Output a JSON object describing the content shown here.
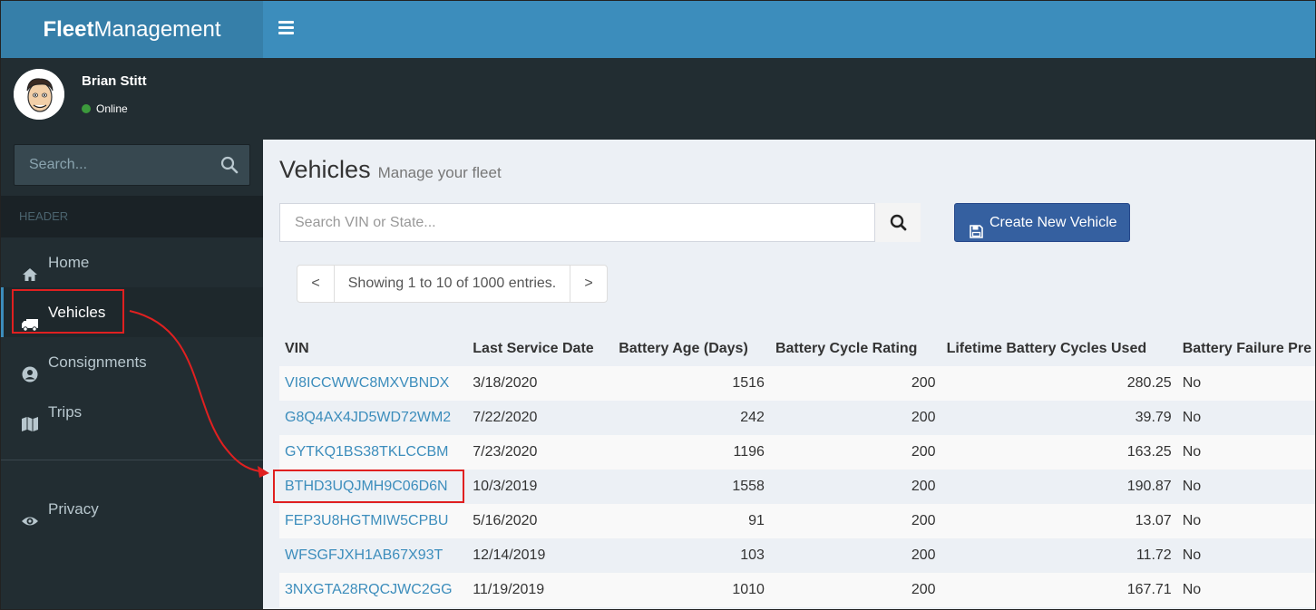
{
  "brand": {
    "bold": "Fleet",
    "rest": "Management"
  },
  "user": {
    "name": "Brian Stitt",
    "status": "Online"
  },
  "sidebar": {
    "search_placeholder": "Search...",
    "header": "HEADER",
    "items": [
      {
        "label": "Home",
        "icon": "home-icon"
      },
      {
        "label": "Vehicles",
        "icon": "truck-icon"
      },
      {
        "label": "Consignments",
        "icon": "user-circle-icon"
      },
      {
        "label": "Trips",
        "icon": "map-icon"
      },
      {
        "label": "Privacy",
        "icon": "eye-icon"
      }
    ]
  },
  "page": {
    "title": "Vehicles",
    "subtitle": "Manage your fleet",
    "search_placeholder": "Search VIN or State...",
    "create_label": "Create New Vehicle",
    "pager": {
      "prev": "<",
      "info": "Showing 1 to 10 of 1000 entries.",
      "next": ">"
    }
  },
  "table": {
    "columns": [
      "VIN",
      "Last Service Date",
      "Battery Age (Days)",
      "Battery Cycle Rating",
      "Lifetime Battery Cycles Used",
      "Battery Failure Pre"
    ],
    "rows": [
      [
        "VI8ICCWWC8MXVBNDX",
        "3/18/2020",
        "1516",
        "200",
        "280.25",
        "No"
      ],
      [
        "G8Q4AX4JD5WD72WM2",
        "7/22/2020",
        "242",
        "200",
        "39.79",
        "No"
      ],
      [
        "GYTKQ1BS38TKLCCBM",
        "7/23/2020",
        "1196",
        "200",
        "163.25",
        "No"
      ],
      [
        "BTHD3UQJMH9C06D6N",
        "10/3/2019",
        "1558",
        "200",
        "190.87",
        "No"
      ],
      [
        "FEP3U8HGTMIW5CPBU",
        "5/16/2020",
        "91",
        "200",
        "13.07",
        "No"
      ],
      [
        "WFSGFJXH1AB67X93T",
        "12/14/2019",
        "103",
        "200",
        "11.72",
        "No"
      ],
      [
        "3NXGTA28RQCJWC2GG",
        "11/19/2019",
        "1010",
        "200",
        "167.71",
        "No"
      ]
    ]
  },
  "colors": {
    "header": "#3c8dbc",
    "sidebar": "#222d32",
    "annotation": "#e02020",
    "link": "#3c8dbc"
  }
}
